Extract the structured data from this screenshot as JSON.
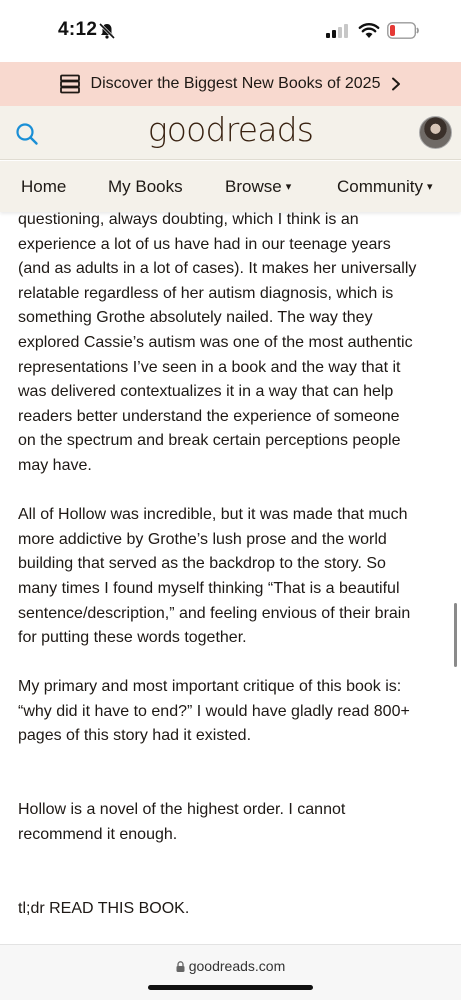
{
  "status_bar": {
    "time": "4:12"
  },
  "promo": {
    "text": "Discover the Biggest New Books of 2025"
  },
  "header": {
    "logo": "goodreads"
  },
  "nav": {
    "home": "Home",
    "my_books": "My Books",
    "browse": "Browse",
    "community": "Community",
    "caret": "▾"
  },
  "review": {
    "lines_p1": [
      "questioning, always doubting, which I think is an",
      "experience a lot of us have had in our teenage years",
      "(and as adults in a lot of cases). It makes her universally",
      "relatable regardless of her autism diagnosis, which is",
      "something Grothe absolutely nailed. The way they",
      "explored Cassie’s autism was one of the most authentic",
      "representations I’ve seen in a book and the way that it",
      "was delivered contextualizes it in a way that can help",
      "readers better understand the experience of someone",
      "on the spectrum and break certain perceptions people",
      "may have."
    ],
    "lines_p2": [
      "All of Hollow was incredible, but it was made that much",
      "more addictive by Grothe’s lush prose and the world",
      "building that served as the backdrop to the story. So",
      "many times I found myself thinking “That is a beautiful",
      "sentence/description,” and feeling envious of their brain",
      "for putting these words together."
    ],
    "lines_p3": [
      "My primary and most important critique of this book is:",
      "“why did it have to end?” I would have gladly read 800+",
      "pages of this story had it existed."
    ],
    "lines_p4": [
      "Hollow is a novel of the highest order. I cannot",
      "recommend it enough."
    ],
    "lines_p5": [
      "tl;dr READ THIS BOOK."
    ]
  },
  "browser": {
    "url": "goodreads.com"
  },
  "colors": {
    "promo_bg": "#f8d9cf",
    "header_bg": "#f4f1ea",
    "logo": "#382110",
    "search_accent": "#1a8fd6",
    "battery_low": "#e53935"
  }
}
